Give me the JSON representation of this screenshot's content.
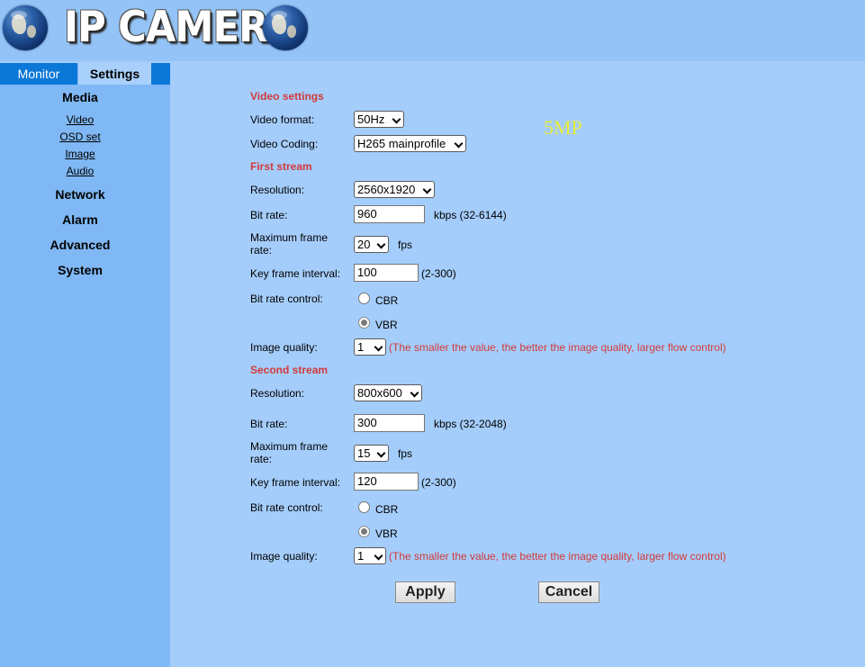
{
  "header": {
    "title": "IP CAMERA"
  },
  "tabs": {
    "monitor": "Monitor",
    "settings": "Settings"
  },
  "menu": {
    "media": "Media",
    "media_items": [
      "Video",
      "OSD set",
      "Image",
      "Audio"
    ],
    "network": "Network",
    "alarm": "Alarm",
    "advanced": "Advanced",
    "system": "System"
  },
  "video_settings": {
    "heading": "Video settings",
    "format_label": "Video format:",
    "format_value": "50Hz",
    "coding_label": "Video Coding:",
    "coding_value": "H265 mainprofile",
    "watermark": "5MP"
  },
  "first_stream": {
    "heading": "First stream",
    "resolution_label": "Resolution:",
    "resolution_value": "2560x1920",
    "bitrate_label": "Bit rate:",
    "bitrate_value": "960",
    "bitrate_hint": "kbps (32-6144)",
    "framerate_label_1": "Maximum frame",
    "framerate_label_2": "rate:",
    "framerate_value": "20",
    "framerate_unit": "fps",
    "keyframe_label": "Key frame interval:",
    "keyframe_value": "100",
    "keyframe_hint": "(2-300)",
    "brc_label": "Bit rate control:",
    "cbr": "CBR",
    "vbr": "VBR",
    "brc_selected": "VBR",
    "quality_label": "Image quality:",
    "quality_value": "1",
    "quality_note": "(The smaller the value, the better the image quality, larger flow control)"
  },
  "second_stream": {
    "heading": "Second stream",
    "resolution_label": "Resolution:",
    "resolution_value": "800x600",
    "bitrate_label": "Bit rate:",
    "bitrate_value": "300",
    "bitrate_hint": "kbps (32-2048)",
    "framerate_label_1": "Maximum frame",
    "framerate_label_2": "rate:",
    "framerate_value": "15",
    "framerate_unit": "fps",
    "keyframe_label": "Key frame interval:",
    "keyframe_value": "120",
    "keyframe_hint": "(2-300)",
    "brc_label": "Bit rate control:",
    "cbr": "CBR",
    "vbr": "VBR",
    "brc_selected": "VBR",
    "quality_label": "Image quality:",
    "quality_value": "1",
    "quality_note": "(The smaller the value, the better the image quality, larger flow control)"
  },
  "buttons": {
    "apply": "Apply",
    "cancel": "Cancel"
  }
}
